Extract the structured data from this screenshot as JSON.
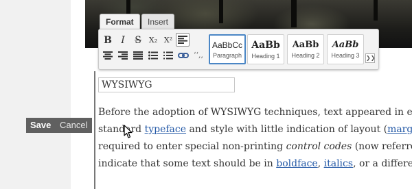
{
  "toolbar": {
    "tabs": [
      {
        "label": "Format"
      },
      {
        "label": "Insert"
      }
    ],
    "row1": [
      {
        "glyph": "B",
        "icon": "bold-icon"
      },
      {
        "glyph": "I",
        "icon": "italic-icon"
      },
      {
        "glyph": "S",
        "icon": "strikethrough-icon"
      },
      {
        "glyph": "X₂",
        "icon": "subscript-icon"
      },
      {
        "glyph": "X²",
        "icon": "superscript-icon"
      },
      {
        "glyph": "",
        "icon": "align-left-icon"
      }
    ],
    "row2": [
      {
        "icon": "align-center-icon"
      },
      {
        "icon": "align-right-icon"
      },
      {
        "icon": "align-justify-icon"
      },
      {
        "icon": "bulleted-list-icon"
      },
      {
        "icon": "numbered-list-icon"
      },
      {
        "icon": "link-icon"
      },
      {
        "glyph": "‘‘,,",
        "icon": "quote-icon"
      }
    ],
    "styles": [
      {
        "sample": "AaBbCc",
        "label": "Paragraph"
      },
      {
        "sample": "AaBb",
        "label": "Heading 1"
      },
      {
        "sample": "AaBb",
        "label": "Heading 2"
      },
      {
        "sample": "AaBb",
        "label": "Heading 3"
      }
    ],
    "expand_glyph": "❯❯"
  },
  "editor": {
    "title_value": "WYSIWYG",
    "line1": "Before the adoption of WYSIWYG techniques, text appeared in edi",
    "line2_pre": "standard ",
    "line2_link1": "typeface",
    "line2_mid": " and style with little indication of layout (",
    "line2_link2": "margins",
    "line3_pre": "required to enter special non-printing ",
    "line3_em": "control codes",
    "line3_post": " (now referred t",
    "line4_pre": "indicate that some text should be in ",
    "line4_link1": "boldface",
    "line4_mid": ", ",
    "line4_link2": "italics",
    "line4_post": ", or a different"
  },
  "actions": {
    "save": "Save",
    "cancel": "Cancel"
  }
}
